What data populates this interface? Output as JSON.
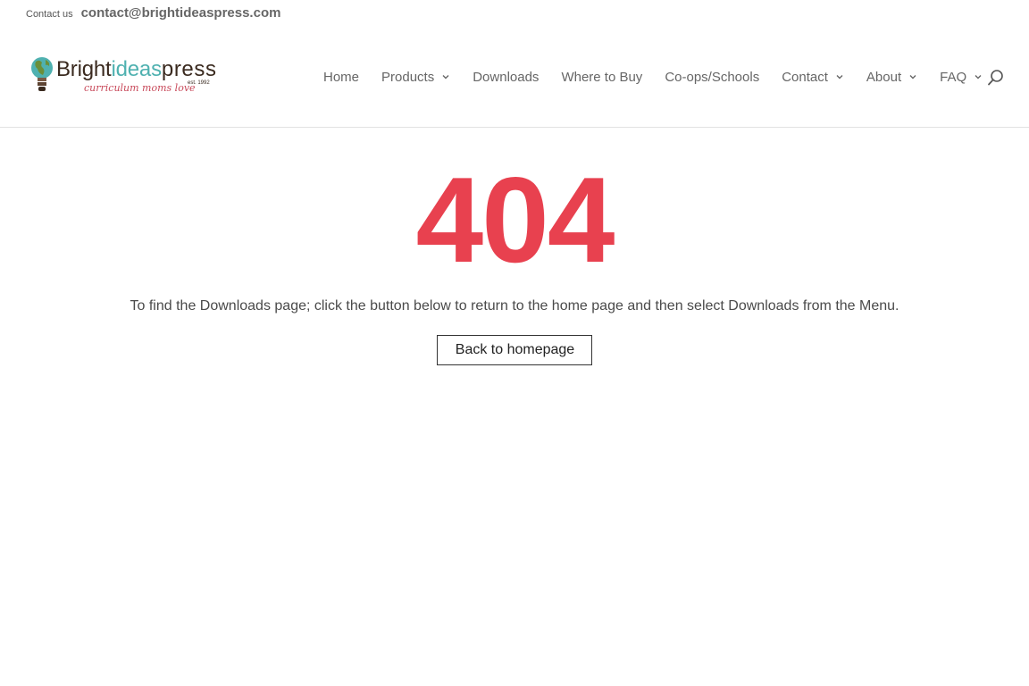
{
  "topbar": {
    "contact_label": "Contact us",
    "contact_email": "contact@brightideaspress.com"
  },
  "logo": {
    "text_bright": "Bright",
    "text_ideas": "ideas",
    "text_press": "press",
    "tagline": "curriculum moms love",
    "est": "est. 1992",
    "colors": {
      "dark": "#3a2a1f",
      "teal": "#4fb1b0",
      "red": "#c8495a"
    }
  },
  "nav": {
    "items": [
      {
        "label": "Home",
        "has_dropdown": false
      },
      {
        "label": "Products",
        "has_dropdown": true
      },
      {
        "label": "Downloads",
        "has_dropdown": false
      },
      {
        "label": "Where to Buy",
        "has_dropdown": false
      },
      {
        "label": "Co-ops/Schools",
        "has_dropdown": false
      },
      {
        "label": "Contact",
        "has_dropdown": true
      },
      {
        "label": "About",
        "has_dropdown": true
      },
      {
        "label": "FAQ",
        "has_dropdown": true
      }
    ],
    "search_icon": "search-icon"
  },
  "content": {
    "error_code": "404",
    "message": "To find the Downloads page; click the button below to return to the home page and then select Downloads from the Menu.",
    "button_label": "Back to homepage"
  },
  "colors": {
    "accent": "#e8414f",
    "nav_text": "#666666",
    "border": "#e2e2e2"
  }
}
